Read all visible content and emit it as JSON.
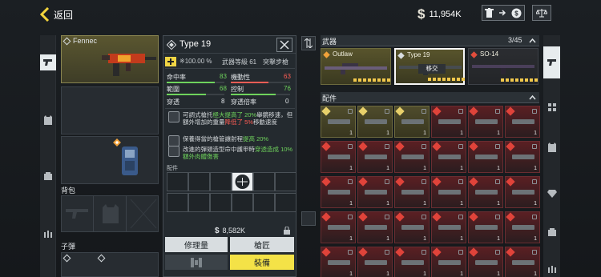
{
  "header": {
    "back_label": "返回",
    "currency_value": "11,954K"
  },
  "left_panel": {
    "primary_name": "Fennec",
    "backpack_label": "背包",
    "bullets_label": "子彈"
  },
  "detail": {
    "weapon_name": "Type 19",
    "durability": "100.00 %",
    "level_label": "武器等級",
    "level_value": "61",
    "class_label": "突擊步槍",
    "stats": [
      {
        "label": "命中率",
        "value": "83",
        "color": "#6fd35c"
      },
      {
        "label": "機動性",
        "value": "63",
        "color": "#ff5d55"
      },
      {
        "label": "範圍",
        "value": "68",
        "color": "#6fd35c"
      },
      {
        "label": "控制",
        "value": "76",
        "color": "#6fd35c"
      },
      {
        "label": "穿透",
        "value": "8",
        "color": "#dfe3e6"
      },
      {
        "label": "穿透倍率",
        "value": "0",
        "color": "#dfe3e6"
      }
    ],
    "desc1_a": "可調式槍托",
    "desc1_b": "極大提高了 20%",
    "desc1_c": "舉鏡移速，但額外增加的重量",
    "desc1_d": "降低了 5%",
    "desc1_e": "移動速度",
    "desc2_a": "保養得當的槍管讓射程",
    "desc2_b": "提高 20%",
    "desc3_a": "改進的彈頭造型命中護甲時",
    "desc3_b": "穿透造成 10% 額外肉體傷害",
    "attachments_label": "配件",
    "price": "8,582K",
    "repair_label": "修理量",
    "gunsmith_label": "槍匠",
    "equip_label": "裝備"
  },
  "right_panel": {
    "weapons_label": "武器",
    "weapons_count": "3/45",
    "weapons": [
      {
        "name": "Outlaw"
      },
      {
        "name": "Type 19",
        "badge": "移交"
      },
      {
        "name": "SO-14"
      }
    ],
    "attachments_label": "配件",
    "cell_count": "1"
  }
}
